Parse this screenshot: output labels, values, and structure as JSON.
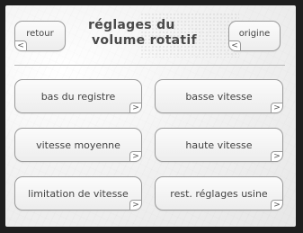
{
  "header": {
    "back_label": "retour",
    "title_line1": "réglages du",
    "title_line2": "volume rotatif",
    "origin_label": "origine"
  },
  "icons": {
    "left_arrow": "<",
    "right_arrow": ">"
  },
  "menu": {
    "items": [
      {
        "label": "bas du registre"
      },
      {
        "label": "basse vitesse"
      },
      {
        "label": "vitesse moyenne"
      },
      {
        "label": "haute vitesse"
      },
      {
        "label": "limitation de vitesse"
      },
      {
        "label": "rest. réglages usine"
      }
    ]
  }
}
